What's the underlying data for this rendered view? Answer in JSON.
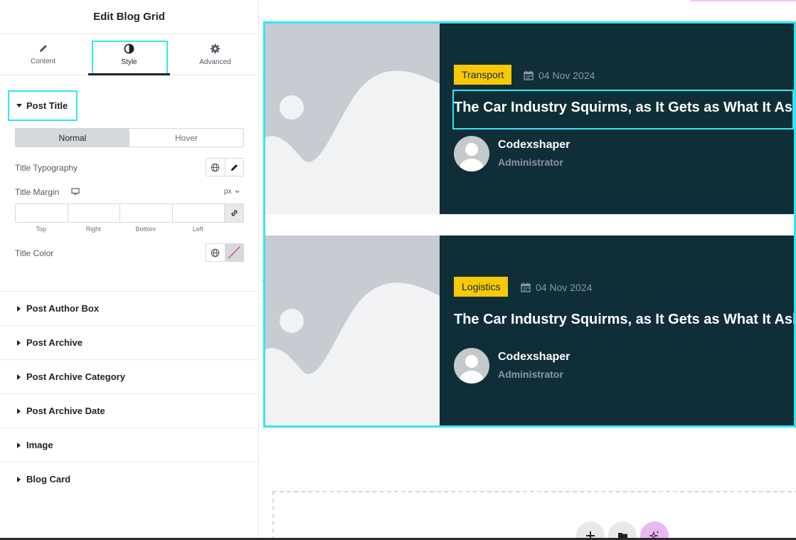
{
  "panel": {
    "title": "Edit Blog Grid",
    "tabs": [
      {
        "label": "Content",
        "icon": "pencil-icon"
      },
      {
        "label": "Style",
        "icon": "contrast-icon"
      },
      {
        "label": "Advanced",
        "icon": "gear-icon"
      }
    ],
    "active_tab": "Style",
    "section_title": "Post Title",
    "state_toggle": {
      "normal": "Normal",
      "hover": "Hover",
      "selected": "Normal"
    },
    "title_typography_label": "Title Typography",
    "title_margin_label": "Title Margin",
    "margin_unit": "px",
    "margin_sides": [
      "Top",
      "Right",
      "Bottom",
      "Left"
    ],
    "title_color_label": "Title Color",
    "collapsed_sections": [
      "Post Author Box",
      "Post Archive",
      "Post Archive Category",
      "Post Archive Date",
      "Image",
      "Blog Card"
    ]
  },
  "posts": [
    {
      "category": "Transport",
      "date": "04 Nov 2024",
      "title": "The Car Industry Squirms, as It Gets as What It Asked",
      "author": "Codexshaper",
      "role": "Administrator"
    },
    {
      "category": "Logistics",
      "date": "04 Nov 2024",
      "title": "The Car Industry Squirms, as It Gets as What It Asked",
      "author": "Codexshaper",
      "role": "Administrator"
    }
  ],
  "colors": {
    "accent_highlight": "#33e7f0",
    "card_background": "#0f2e38",
    "badge": "#f9c805",
    "placeholder": "#c6ccd2",
    "ai_button": "#e9b7f2"
  },
  "fab_icons": [
    "plus-icon",
    "folder-icon",
    "sparkle-icon"
  ]
}
